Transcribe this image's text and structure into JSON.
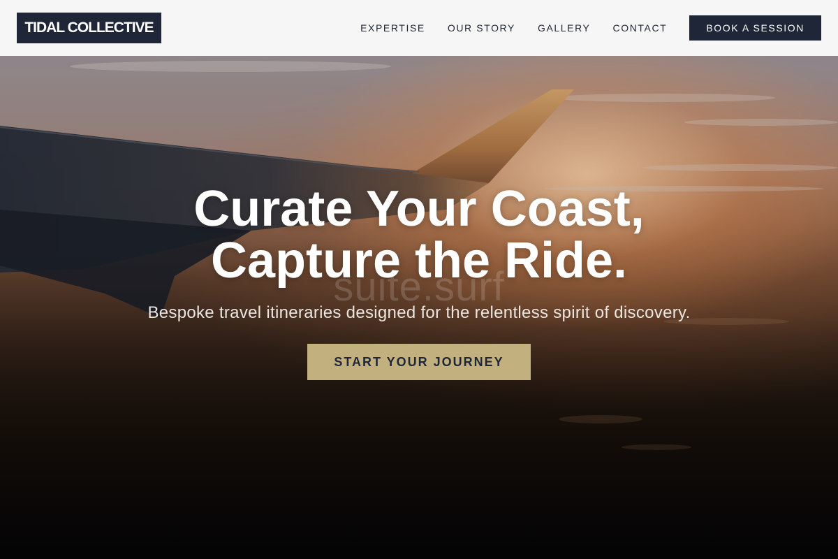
{
  "header": {
    "logo_text": "TIDAL COLLECTIVE",
    "nav": [
      {
        "label": "EXPERTISE"
      },
      {
        "label": "OUR STORY"
      },
      {
        "label": "GALLERY"
      },
      {
        "label": "CONTACT"
      }
    ],
    "cta_label": "BOOK A SESSION"
  },
  "hero": {
    "title_line1": "Curate Your Coast,",
    "title_line2": "Capture the Ride.",
    "subtitle": "Bespoke travel itineraries designed for the relentless spirit of discovery.",
    "cta_label": "START YOUR JOURNEY",
    "watermark": "suite.surf",
    "background_image": "airplane-wing-sunset-photo"
  },
  "colors": {
    "navy": "#1e2638",
    "gold": "#c3b07f",
    "header_bg": "#fafafa",
    "white": "#ffffff"
  }
}
